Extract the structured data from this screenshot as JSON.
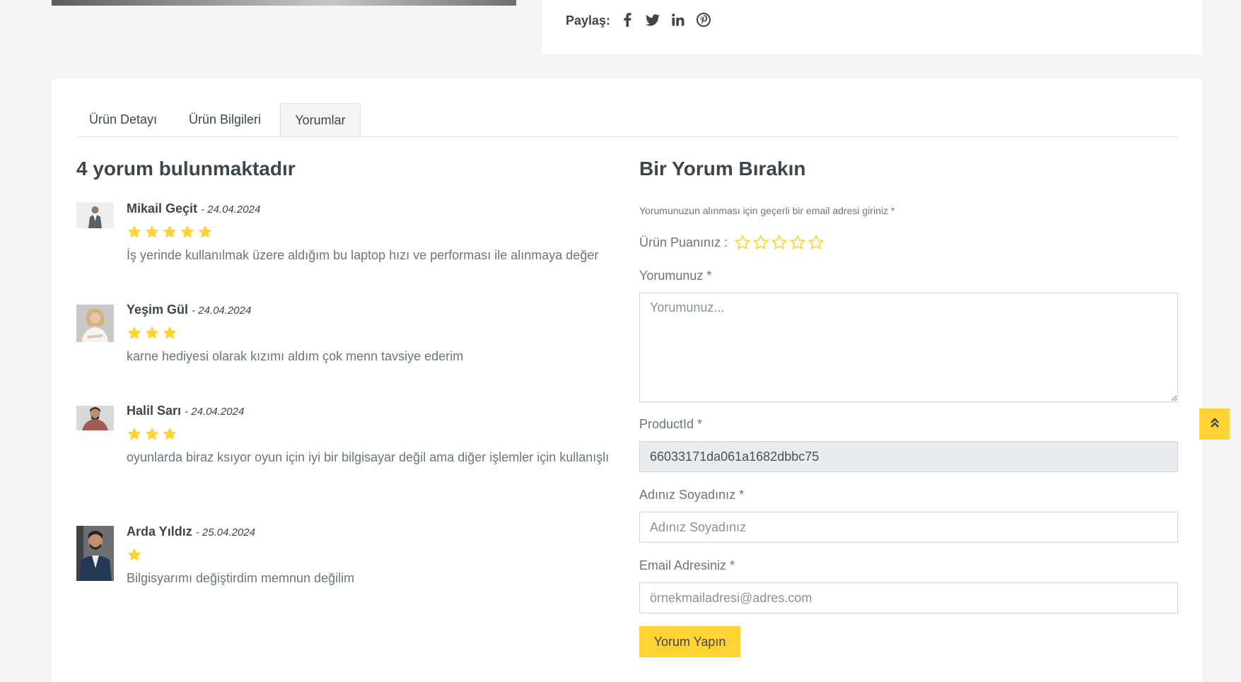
{
  "share": {
    "label": "Paylaş:",
    "icons": [
      "facebook-icon",
      "twitter-icon",
      "linkedin-icon",
      "pinterest-icon"
    ]
  },
  "tabs": [
    "Ürün Detayı",
    "Ürün Bilgileri",
    "Yorumlar"
  ],
  "active_tab": "Yorumlar",
  "reviews_heading": "4 yorum bulunmaktadır",
  "reviews": [
    {
      "name": "Mikail Geçit",
      "date": "- 24.04.2024",
      "rating": 5,
      "text": "İş yerinde kullanılmak üzere aldığım bu laptop hızı ve performası ile alınmaya değer"
    },
    {
      "name": "Yeşim Gül",
      "date": "- 24.04.2024",
      "rating": 3,
      "text": "karne hediyesi olarak kızımı aldım çok menn tavsiye ederim"
    },
    {
      "name": "Halil Sarı",
      "date": "- 24.04.2024",
      "rating": 3,
      "text": "oyunlarda biraz ksıyor oyun için iyi bir bilgisayar değil ama diğer işlemler için kullanışlı"
    },
    {
      "name": "Arda Yıldız",
      "date": "- 25.04.2024",
      "rating": 1,
      "text": "Bilgisyarımı değiştirdim memnun değilim"
    }
  ],
  "form": {
    "heading": "Bir Yorum Bırakın",
    "note": "Yorumunuzun alınması için geçerli bir email adresi giriniz *",
    "rating_label": "Ürün Puanınız :",
    "rating_value": 0,
    "rating_max": 5,
    "comment_label": "Yorumunuz *",
    "comment_placeholder": "Yorumunuz...",
    "product_label": "ProductId *",
    "product_value": "66033171da061a1682dbbc75",
    "name_label": "Adınız Soyadınız *",
    "name_placeholder": "Adınız Soyadınız",
    "email_label": "Email Adresiniz *",
    "email_placeholder": "örnekmailadresi@adres.com",
    "submit_label": "Yorum Yapın"
  },
  "colors": {
    "accent": "#ffd333",
    "text_dark": "#3d464d",
    "text_muted": "#6c757d",
    "page_bg": "#f5f5f5"
  }
}
